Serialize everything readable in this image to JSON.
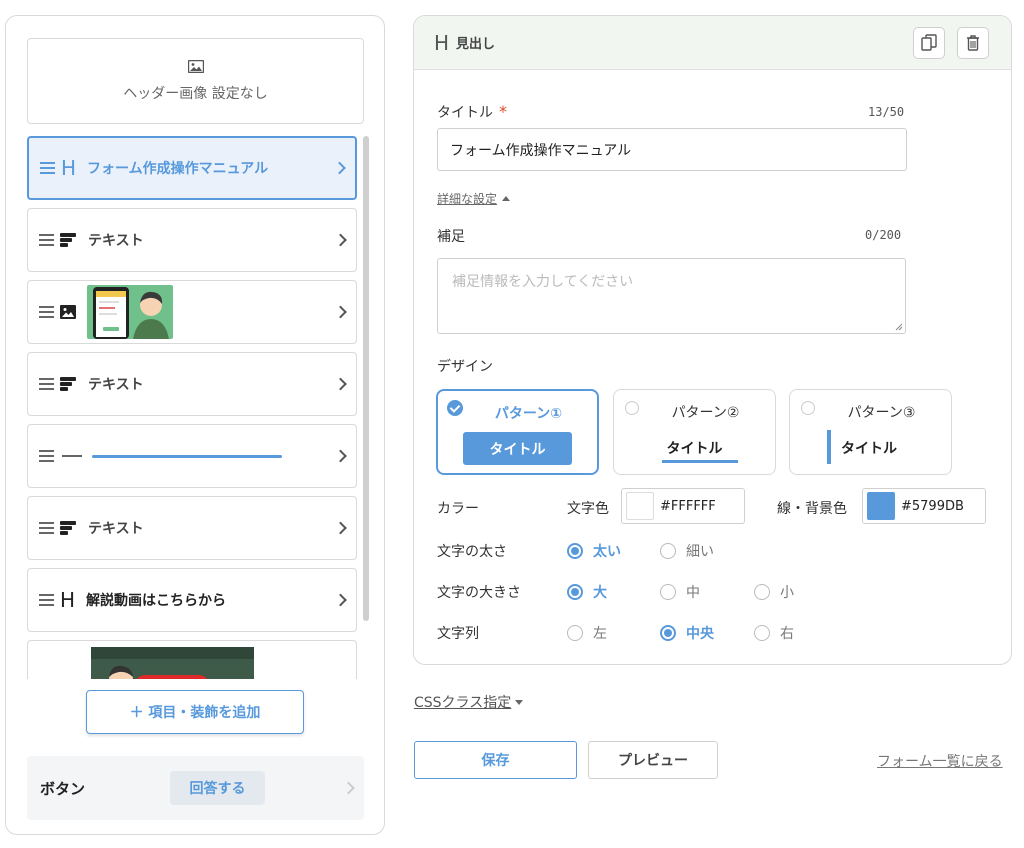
{
  "left": {
    "header_image_label": "ヘッダー画像 設定なし",
    "items": [
      {
        "type": "heading",
        "label": "フォーム作成操作マニュアル",
        "active": true
      },
      {
        "type": "text",
        "label": "テキスト"
      },
      {
        "type": "image",
        "label": ""
      },
      {
        "type": "text",
        "label": "テキスト"
      },
      {
        "type": "divider",
        "label": ""
      },
      {
        "type": "text",
        "label": "テキスト"
      },
      {
        "type": "heading",
        "label": "解説動画はこちらから"
      },
      {
        "type": "video",
        "label": ""
      }
    ],
    "add_button_label": "＋ 項目・装飾を追加",
    "button_section": {
      "label": "ボタン",
      "button_text": "回答する"
    }
  },
  "editor": {
    "header_icon": "H",
    "header_title": "見出し",
    "title_label": "タイトル",
    "required_mark": "*",
    "title_counter": "13/50",
    "title_value": "フォーム作成操作マニュアル",
    "detail_link": "詳細な設定",
    "supplement_label": "補足",
    "supplement_counter": "0/200",
    "supplement_placeholder": "補足情報を入力してください",
    "design_label": "デザイン",
    "patterns": [
      {
        "name": "パターン①",
        "preview": "タイトル",
        "selected": true
      },
      {
        "name": "パターン②",
        "preview": "タイトル",
        "selected": false
      },
      {
        "name": "パターン③",
        "preview": "タイトル",
        "selected": false
      }
    ],
    "color_label": "カラー",
    "text_color_label": "文字色",
    "text_color_hex": "#FFFFFF",
    "bg_color_label": "線・背景色",
    "bg_color_hex": "#5799DB",
    "weight": {
      "label": "文字の太さ",
      "options": [
        "太い",
        "細い"
      ],
      "selected": "太い"
    },
    "size": {
      "label": "文字の大きさ",
      "options": [
        "大",
        "中",
        "小"
      ],
      "selected": "大"
    },
    "align": {
      "label": "文字列",
      "options": [
        "左",
        "中央",
        "右"
      ],
      "selected": "中央"
    }
  },
  "footer": {
    "css_class_link": "CSSクラス指定",
    "save_label": "保存",
    "preview_label": "プレビュー",
    "back_link": "フォーム一覧に戻る"
  },
  "colors": {
    "accent": "#5799db",
    "header_bg": "#f1f6f1"
  }
}
